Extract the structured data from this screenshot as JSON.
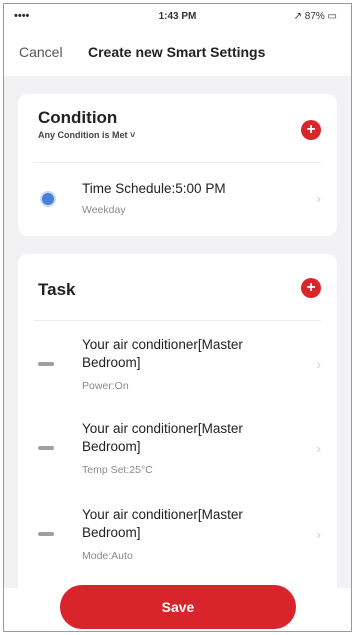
{
  "status_bar": {
    "signal": "••••",
    "time": "1:43 PM",
    "battery": "↗ 87% ▭"
  },
  "nav": {
    "cancel_label": "Cancel",
    "title": "Create new Smart Settings"
  },
  "condition": {
    "title": "Condition",
    "subtitle": "Any Condition is Met ˅",
    "add_icon": "+",
    "items": [
      {
        "title": "Time Schedule:5:00 PM",
        "sub": "Weekday"
      }
    ]
  },
  "task": {
    "title": "Task",
    "add_icon": "+",
    "items": [
      {
        "title": "Your air conditioner[Master Bedroom]",
        "sub": "Power:On"
      },
      {
        "title": "Your air conditioner[Master Bedroom]",
        "sub": "Temp Set:25°C"
      },
      {
        "title": "Your air conditioner[Master Bedroom]",
        "sub": "Mode:Auto"
      }
    ]
  },
  "chevron": "›",
  "save_label": "Save",
  "colors": {
    "accent": "#d8242a",
    "clock_icon": "#4a7fd8",
    "background": "#f2f2f4"
  }
}
